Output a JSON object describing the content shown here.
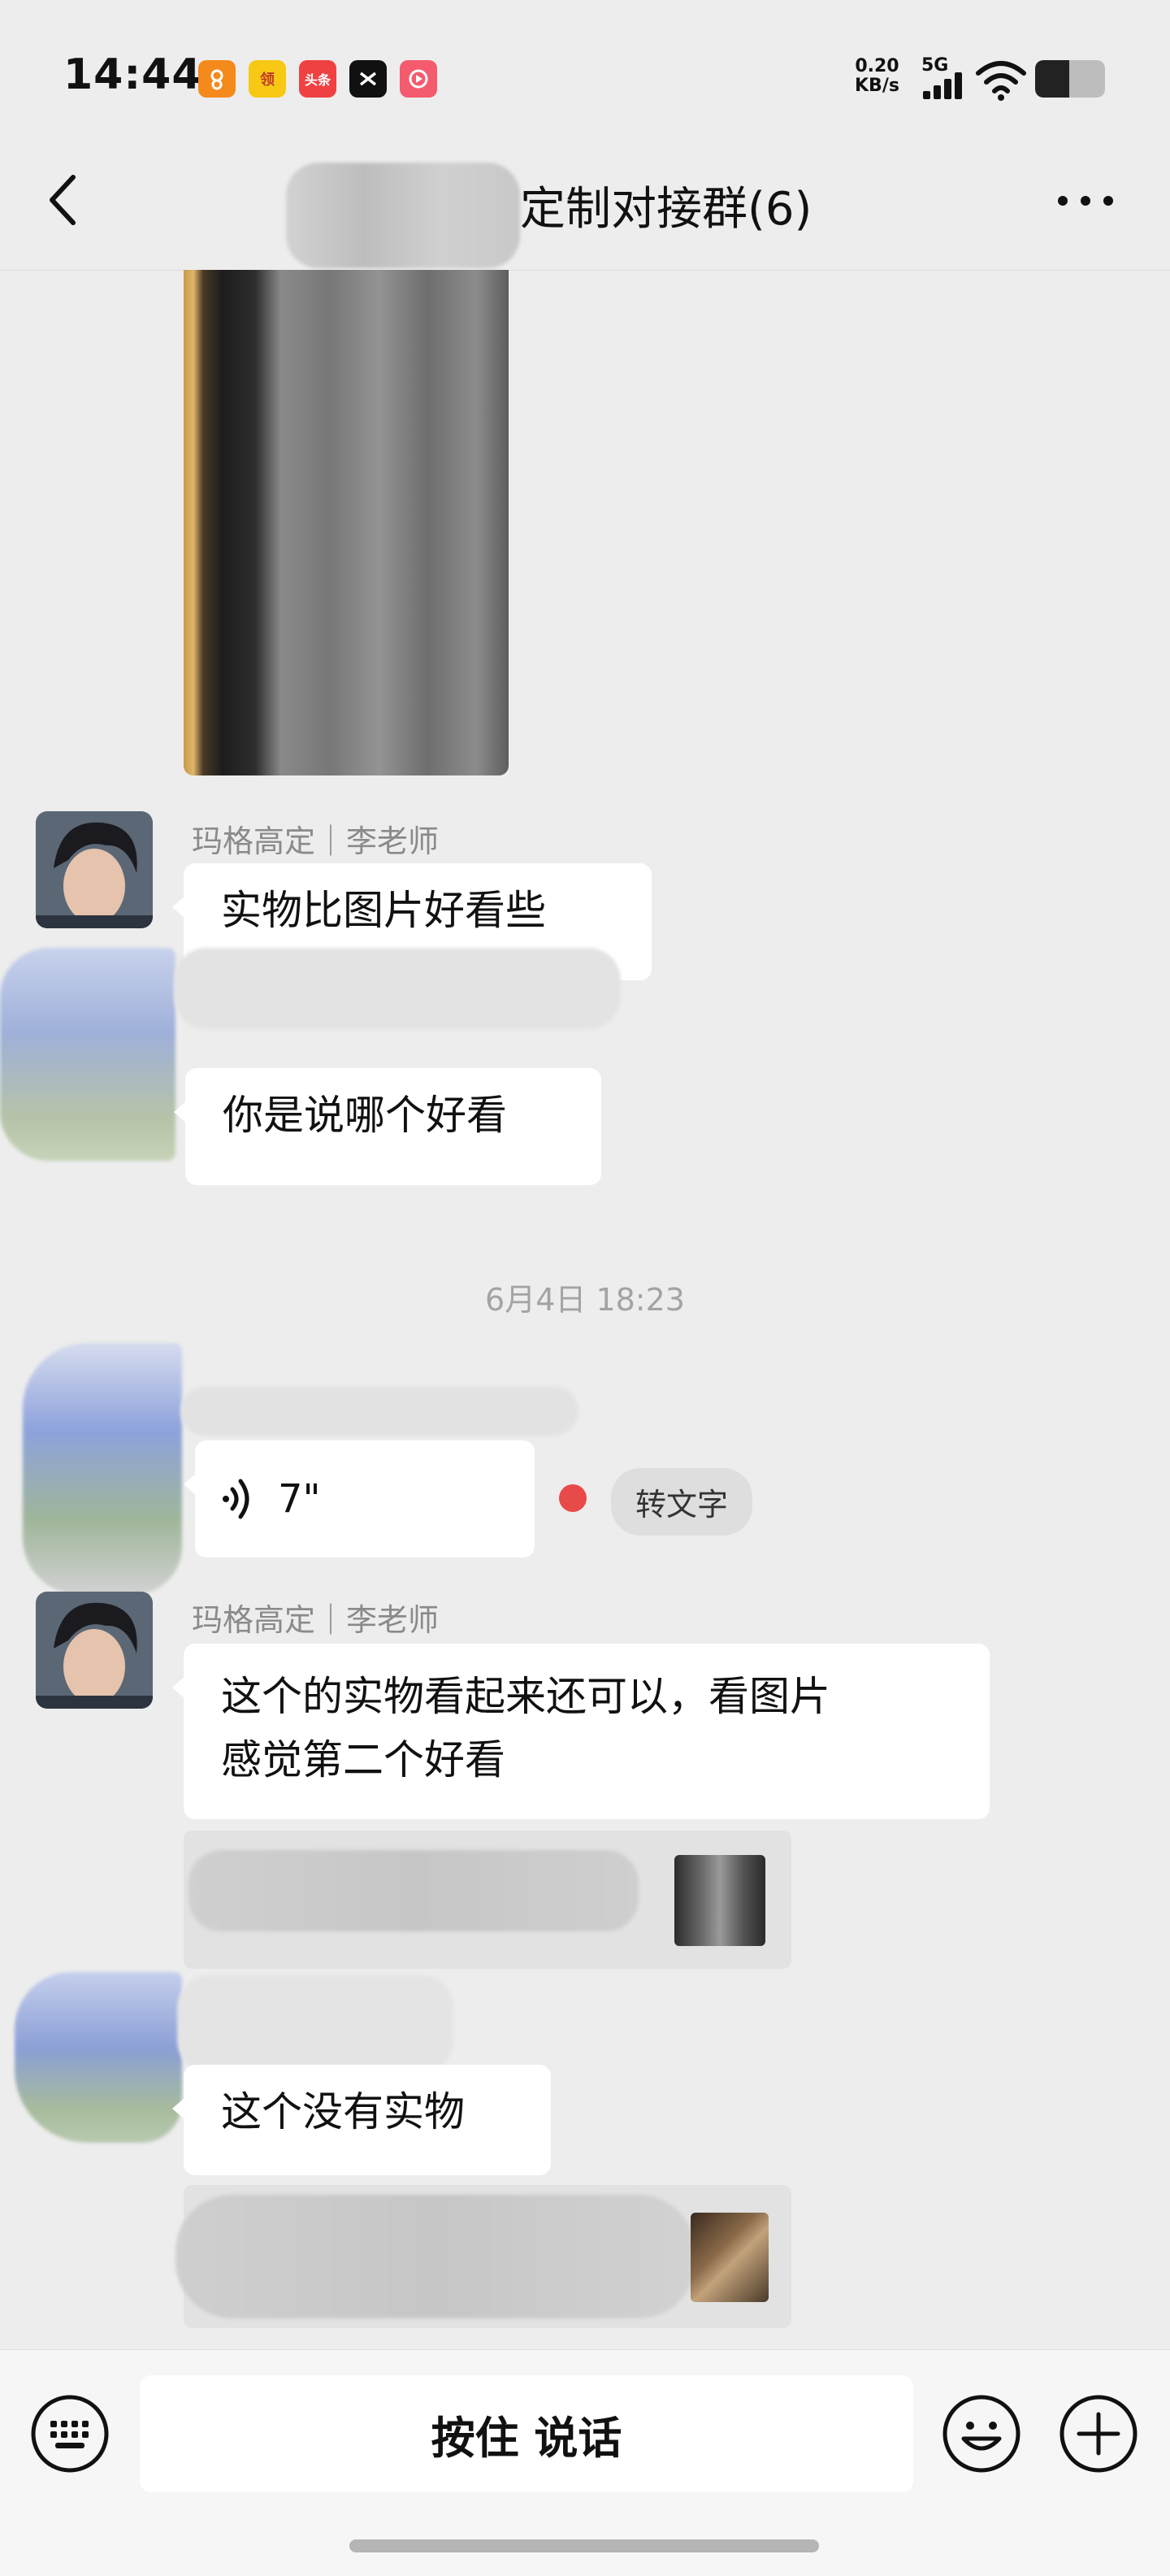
{
  "status_bar": {
    "time": "14:44",
    "net_speed_value": "0.20",
    "net_speed_unit": "KB/s",
    "network": "5G",
    "app_icons": [
      {
        "name": "app-icon-orange",
        "color": "#f48a1c",
        "label": ""
      },
      {
        "name": "app-icon-yellow",
        "color": "#f7c814",
        "label": "领"
      },
      {
        "name": "app-icon-toutiao",
        "color": "#f04142",
        "label": "头条"
      },
      {
        "name": "app-icon-capcut",
        "color": "#111111",
        "label": ""
      },
      {
        "name": "app-icon-video",
        "color": "#f45b6e",
        "label": ""
      }
    ]
  },
  "header": {
    "title": "定制对接群(6)"
  },
  "messages": [
    {
      "type": "image",
      "side": "left"
    },
    {
      "type": "text",
      "sender": "玛格高定｜李老师",
      "text": "实物比图片好看些"
    },
    {
      "type": "text",
      "sender": "",
      "text": "你是说哪个好看"
    },
    {
      "type": "timestamp",
      "text": "6月4日 18:23"
    },
    {
      "type": "voice",
      "sender": "",
      "duration": "7\"",
      "to_text_label": "转文字"
    },
    {
      "type": "text",
      "sender": "玛格高定｜李老师",
      "text_line1": "这个的实物看起来还可以，看图片",
      "text_line2": "感觉第二个好看"
    },
    {
      "type": "quote"
    },
    {
      "type": "text",
      "sender": "",
      "text": "这个没有实物"
    },
    {
      "type": "quote"
    }
  ],
  "input_bar": {
    "hold_to_talk_label": "按住 说话"
  },
  "colors": {
    "background": "#ededed",
    "bubble": "#ffffff",
    "unread_dot": "#e84a4a"
  }
}
